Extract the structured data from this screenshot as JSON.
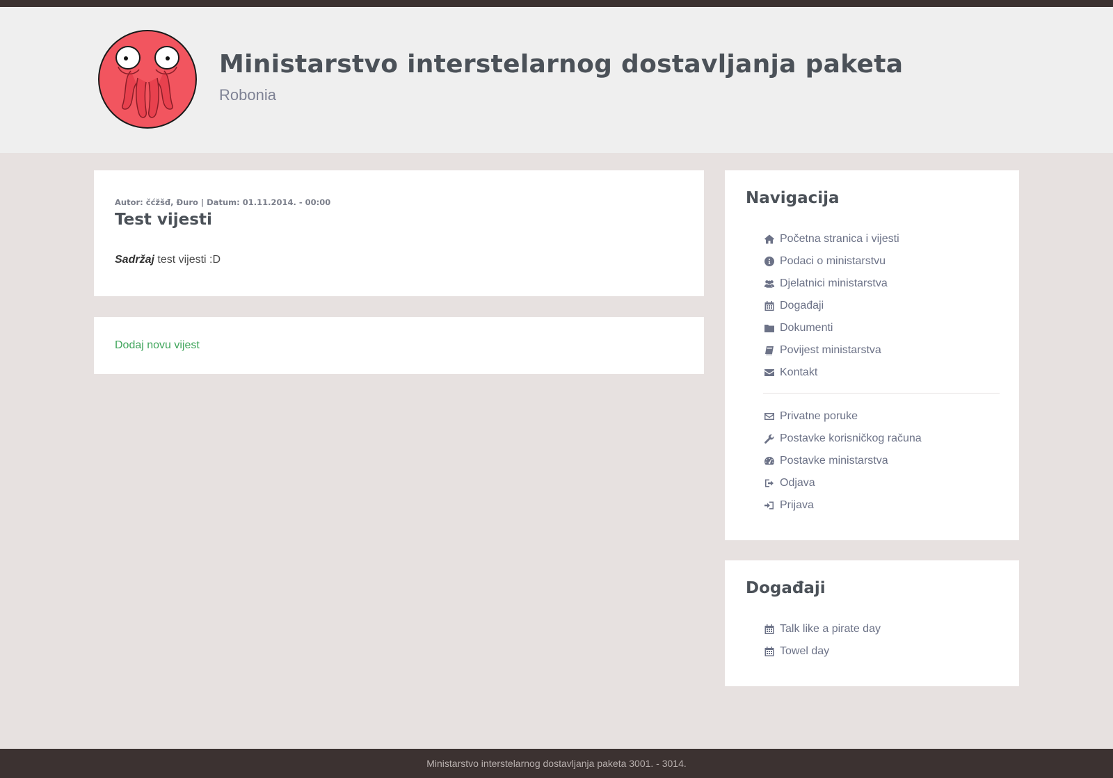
{
  "header": {
    "title": "Ministarstvo interstelarnog dostavljanja paketa",
    "subtitle": "Robonia",
    "logo_icon": "octopus-alien-logo"
  },
  "news": {
    "meta": "Autor: čćžšđ, Đuro | Datum: 01.11.2014. - 00:00",
    "title": "Test vijesti",
    "content_label": "Sadržaj",
    "content_text": " test vijesti :D"
  },
  "add_news": {
    "label": "Dodaj novu vijest"
  },
  "navigation": {
    "heading": "Navigacija",
    "main_items": [
      {
        "label": "Početna stranica i vijesti",
        "icon": "home-icon"
      },
      {
        "label": "Podaci o ministarstvu",
        "icon": "info-circle-icon"
      },
      {
        "label": "Djelatnici ministarstva",
        "icon": "users-icon"
      },
      {
        "label": "Događaji",
        "icon": "calendar-icon"
      },
      {
        "label": "Dokumenti",
        "icon": "folder-icon"
      },
      {
        "label": "Povijest ministarstva",
        "icon": "book-icon"
      },
      {
        "label": "Kontakt",
        "icon": "envelope-icon"
      }
    ],
    "user_items": [
      {
        "label": "Privatne poruke",
        "icon": "envelope-outline-icon"
      },
      {
        "label": "Postavke korisničkog računa",
        "icon": "wrench-icon"
      },
      {
        "label": "Postavke ministarstva",
        "icon": "dashboard-icon"
      },
      {
        "label": "Odjava",
        "icon": "sign-out-icon"
      },
      {
        "label": "Prijava",
        "icon": "sign-in-icon"
      }
    ]
  },
  "events": {
    "heading": "Događaji",
    "items": [
      {
        "label": "Talk like a pirate day",
        "icon": "calendar-icon"
      },
      {
        "label": "Towel day",
        "icon": "calendar-icon"
      }
    ]
  },
  "footer": {
    "text": "Ministarstvo interstelarnog dostavljanja paketa 3001. - 3014."
  },
  "colors": {
    "page_bg": "#e7e1e0",
    "header_bg": "#efefef",
    "dark_bar": "#3c3231",
    "link_green": "#3fa55b",
    "nav_text": "#6c7287",
    "heading": "#4b5158",
    "logo_red": "#f2555f"
  }
}
